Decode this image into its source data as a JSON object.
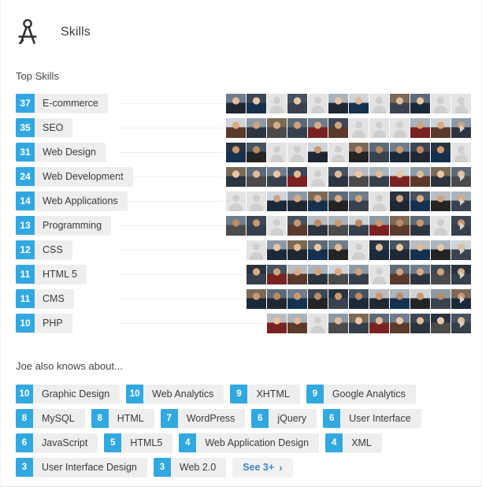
{
  "header": {
    "title": "Skills",
    "icon": "compass-icon"
  },
  "top_skills": {
    "title": "Top Skills",
    "items": [
      {
        "count": "37",
        "label": "E-commerce",
        "avatars_start": 286,
        "avatars": 12,
        "photos": [
          1,
          1,
          0,
          1,
          0,
          1,
          1,
          0,
          1,
          1,
          0,
          0
        ]
      },
      {
        "count": "35",
        "label": "SEO",
        "avatars_start": 286,
        "avatars": 12,
        "photos": [
          1,
          1,
          1,
          1,
          1,
          1,
          0,
          0,
          0,
          1,
          1,
          1
        ]
      },
      {
        "count": "31",
        "label": "Web Design",
        "avatars_start": 286,
        "avatars": 12,
        "photos": [
          1,
          1,
          0,
          0,
          1,
          0,
          1,
          1,
          1,
          1,
          1,
          0
        ]
      },
      {
        "count": "24",
        "label": "Web Development",
        "avatars_start": 286,
        "avatars": 12,
        "photos": [
          1,
          1,
          1,
          1,
          0,
          1,
          1,
          1,
          1,
          1,
          1,
          1
        ]
      },
      {
        "count": "14",
        "label": "Web Applications",
        "avatars_start": 286,
        "avatars": 12,
        "photos": [
          0,
          0,
          1,
          1,
          1,
          1,
          1,
          0,
          1,
          1,
          1,
          1
        ]
      },
      {
        "count": "13",
        "label": "Programming",
        "avatars_start": 286,
        "avatars": 12,
        "photos": [
          1,
          1,
          0,
          1,
          1,
          1,
          1,
          1,
          1,
          1,
          0,
          1
        ]
      },
      {
        "count": "12",
        "label": "CSS",
        "avatars_start": 312,
        "avatars": 11,
        "photos": [
          0,
          1,
          1,
          1,
          1,
          0,
          1,
          1,
          1,
          1,
          1
        ]
      },
      {
        "count": "11",
        "label": "HTML 5",
        "avatars_start": 312,
        "avatars": 11,
        "photos": [
          1,
          1,
          1,
          1,
          1,
          1,
          0,
          1,
          1,
          1,
          1
        ]
      },
      {
        "count": "11",
        "label": "CMS",
        "avatars_start": 312,
        "avatars": 11,
        "photos": [
          1,
          1,
          1,
          1,
          1,
          1,
          1,
          1,
          1,
          1,
          1
        ]
      },
      {
        "count": "10",
        "label": "PHP",
        "avatars_start": 338,
        "avatars": 10,
        "photos": [
          1,
          1,
          0,
          1,
          1,
          1,
          1,
          1,
          1,
          1
        ]
      }
    ],
    "row_arrow": "chevron-right-icon"
  },
  "also_knows": {
    "title": "Joe also knows about...",
    "items": [
      {
        "count": "10",
        "label": "Graphic Design"
      },
      {
        "count": "10",
        "label": "Web Analytics"
      },
      {
        "count": "9",
        "label": "XHTML"
      },
      {
        "count": "9",
        "label": "Google Analytics"
      },
      {
        "count": "8",
        "label": "MySQL"
      },
      {
        "count": "8",
        "label": "HTML"
      },
      {
        "count": "7",
        "label": "WordPress"
      },
      {
        "count": "6",
        "label": "jQuery"
      },
      {
        "count": "6",
        "label": "User Interface"
      },
      {
        "count": "6",
        "label": "JavaScript"
      },
      {
        "count": "5",
        "label": "HTML5"
      },
      {
        "count": "4",
        "label": "Web Application Design"
      },
      {
        "count": "4",
        "label": "XML"
      },
      {
        "count": "3",
        "label": "User Interface Design"
      },
      {
        "count": "3",
        "label": "Web 2.0"
      }
    ],
    "see_more": {
      "label": "See 3+",
      "chevron": "›"
    }
  },
  "colors": {
    "badge_blue": "#32a8e0",
    "pill_gray": "#eeeeee",
    "link_blue": "#3d87c4",
    "arrow_gray": "#d2d2d2",
    "text_dark": "#3a3a3a"
  }
}
